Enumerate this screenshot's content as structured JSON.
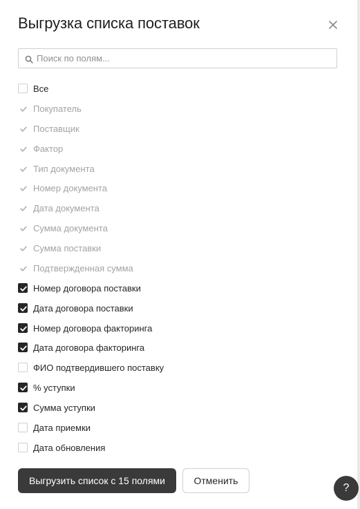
{
  "dialog": {
    "title": "Выгрузка списка поставок",
    "close_icon": "close-icon"
  },
  "search": {
    "placeholder": "Поиск по полям...",
    "value": "",
    "icon": "search-icon"
  },
  "fields": [
    {
      "label": "Все",
      "checked": false,
      "disabled": false
    },
    {
      "label": "Покупатель",
      "checked": true,
      "disabled": true
    },
    {
      "label": "Поставщик",
      "checked": true,
      "disabled": true
    },
    {
      "label": "Фактор",
      "checked": true,
      "disabled": true
    },
    {
      "label": "Тип документа",
      "checked": true,
      "disabled": true
    },
    {
      "label": "Номер документа",
      "checked": true,
      "disabled": true
    },
    {
      "label": "Дата документа",
      "checked": true,
      "disabled": true
    },
    {
      "label": "Сумма документа",
      "checked": true,
      "disabled": true
    },
    {
      "label": "Сумма поставки",
      "checked": true,
      "disabled": true
    },
    {
      "label": "Подтвержденная сумма",
      "checked": true,
      "disabled": true
    },
    {
      "label": "Номер договора поставки",
      "checked": true,
      "disabled": false
    },
    {
      "label": "Дата договора поставки",
      "checked": true,
      "disabled": false
    },
    {
      "label": "Номер договора факторинга",
      "checked": true,
      "disabled": false
    },
    {
      "label": "Дата договора факторинга",
      "checked": true,
      "disabled": false
    },
    {
      "label": "ФИО подтвердившего поставку",
      "checked": false,
      "disabled": false
    },
    {
      "label": "% уступки",
      "checked": true,
      "disabled": false
    },
    {
      "label": "Сумма уступки",
      "checked": true,
      "disabled": false
    },
    {
      "label": "Дата приемки",
      "checked": false,
      "disabled": false
    },
    {
      "label": "Дата обновления",
      "checked": false,
      "disabled": false
    }
  ],
  "actions": {
    "export_label": "Выгрузить список с 15 полями",
    "cancel_label": "Отменить"
  },
  "help": {
    "label": "?",
    "icon": "help-icon"
  },
  "colors": {
    "primary_button": "#3a3a3a",
    "checkbox_checked": "#262626",
    "disabled_text": "#a3a3a3"
  }
}
